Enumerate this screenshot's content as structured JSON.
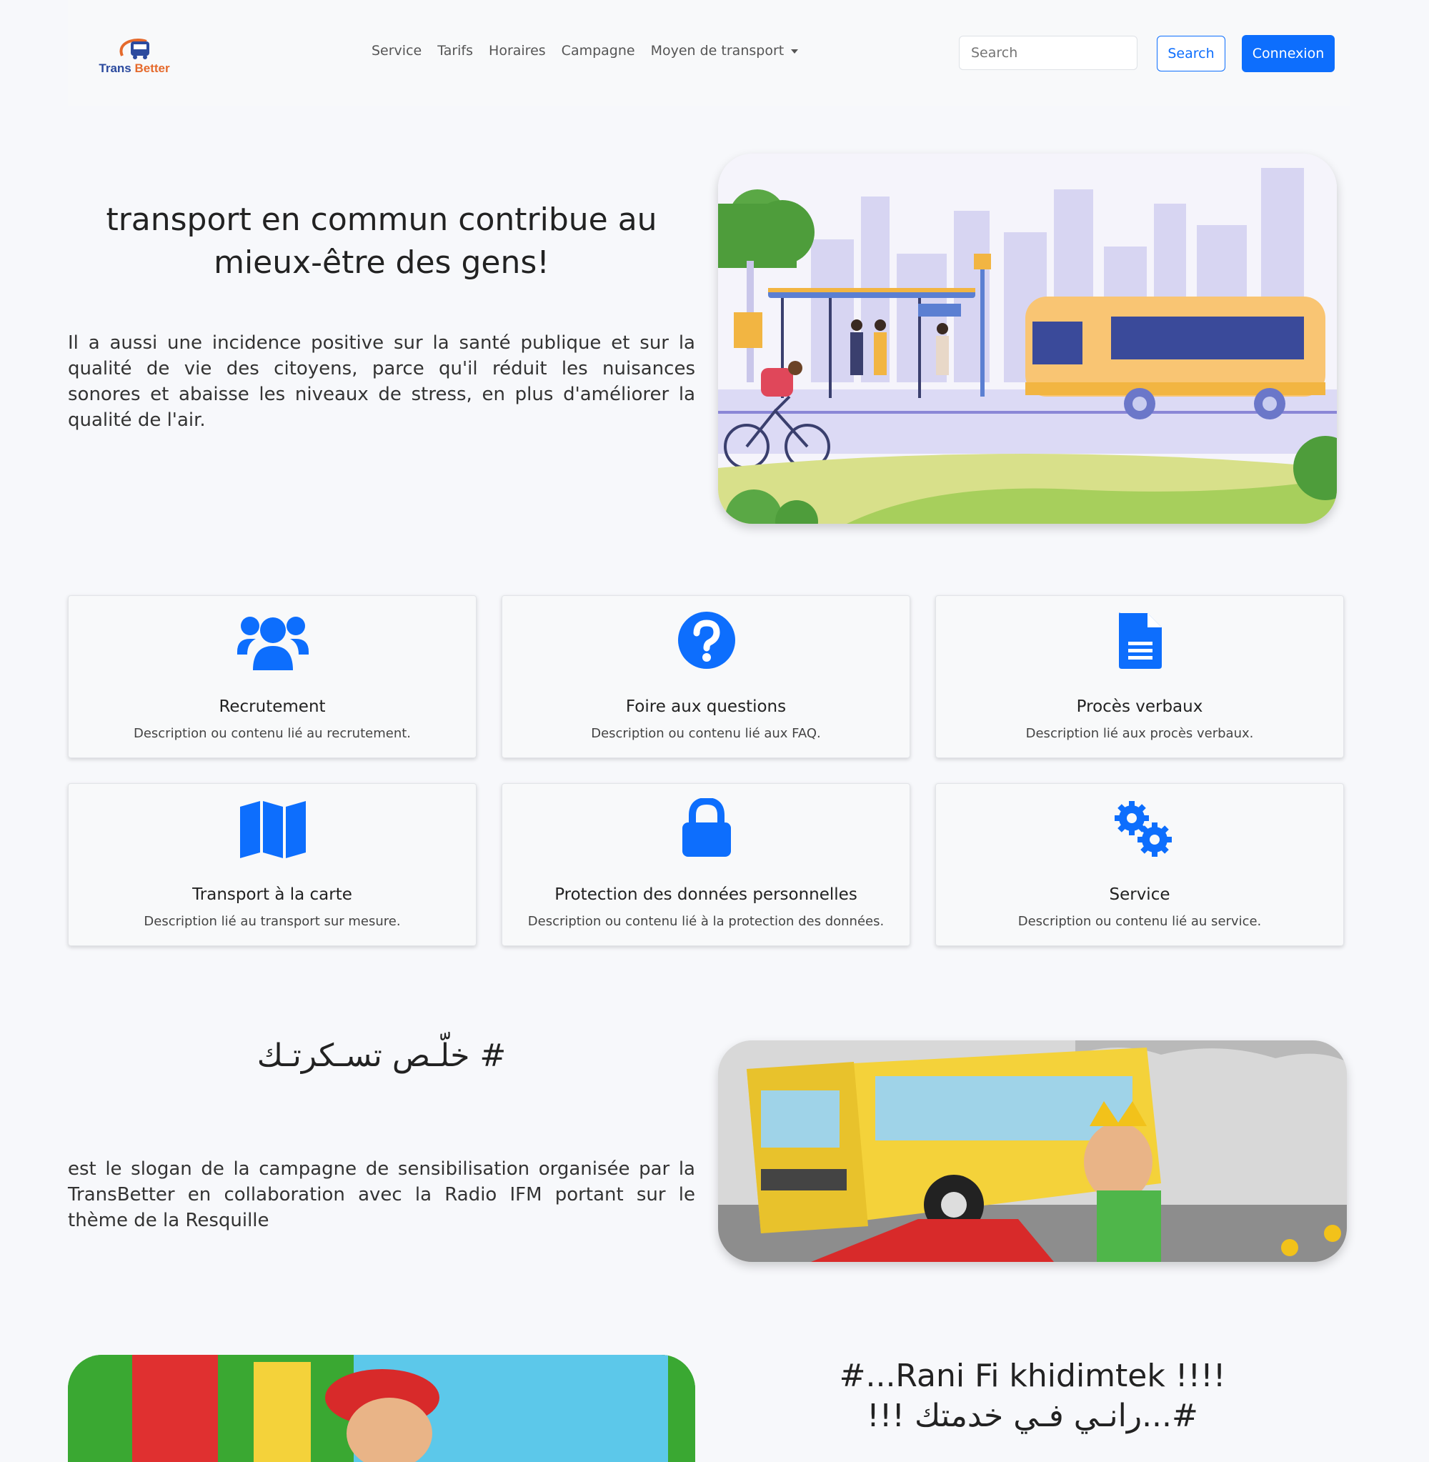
{
  "brand": {
    "name_part1": "Trans",
    "name_part2": "Better"
  },
  "nav": {
    "items": [
      {
        "label": "Service"
      },
      {
        "label": "Tarifs"
      },
      {
        "label": "Horaires"
      },
      {
        "label": "Campagne"
      },
      {
        "label": "Moyen de transport"
      }
    ],
    "search_placeholder": "Search",
    "search_button": "Search",
    "login_button": "Connexion"
  },
  "hero": {
    "title": "transport en commun contribue au mieux-être des gens!",
    "text": "Il a aussi une incidence positive sur la santé publique et sur la qualité de vie des citoyens, parce qu'il réduit les nuisances sonores et abaisse les niveaux de stress, en plus d'améliorer la qualité de l'air."
  },
  "cards": [
    {
      "icon": "users-icon",
      "title": "Recrutement",
      "desc": "Description ou contenu lié au recrutement."
    },
    {
      "icon": "question-circle-icon",
      "title": "Foire aux questions",
      "desc": "Description ou contenu lié aux FAQ."
    },
    {
      "icon": "file-icon",
      "title": "Procès verbaux",
      "desc": "Description lié aux procès verbaux."
    },
    {
      "icon": "map-icon",
      "title": "Transport à la carte",
      "desc": "Description lié au transport sur mesure."
    },
    {
      "icon": "lock-icon",
      "title": "Protection des données personnelles",
      "desc": "Description ou contenu lié à la protection des données."
    },
    {
      "icon": "gears-icon",
      "title": "Service",
      "desc": "Description ou contenu lié au service."
    }
  ],
  "campaign": {
    "slogan": "# خلّـص تسـكرتـك",
    "text": "est le slogan de la campagne de sensibilisation organisée par la TransBetter en collaboration avec la Radio IFM portant sur le thème de la Resquille"
  },
  "rani": {
    "line1": "#...Rani Fi khidimtek !!!!",
    "line2": "#...رانـي فـي خدمتك !!!"
  },
  "colors": {
    "primary": "#0d6efd",
    "background": "#f7f8fb"
  }
}
